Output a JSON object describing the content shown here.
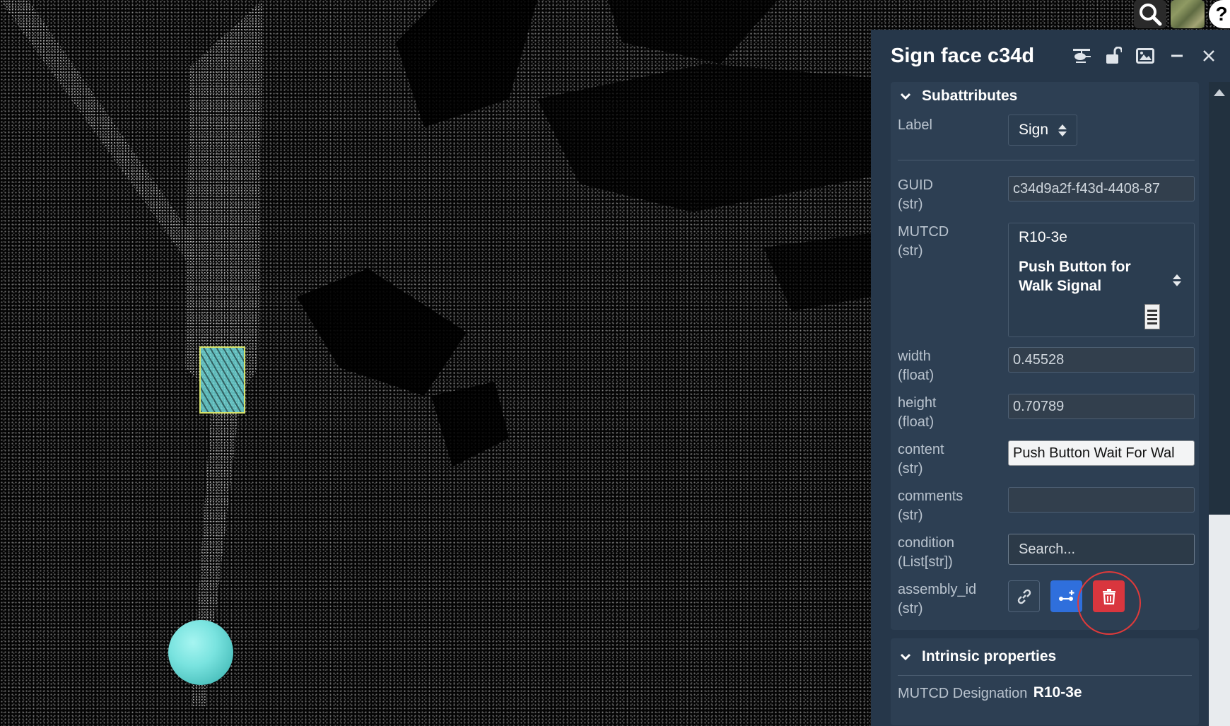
{
  "panel": {
    "title": "Sign face c34d"
  },
  "header_icons": [
    "helicopter-icon",
    "unlock-icon",
    "image-icon",
    "minimize-icon",
    "close-icon"
  ],
  "topbar": {
    "icons": [
      "search-icon",
      "map-thumbnail",
      "help-icon"
    ],
    "help_label": "?"
  },
  "subattributes": {
    "title": "Subattributes",
    "label": {
      "name": "Label",
      "value": "Sign"
    },
    "guid": {
      "name": "GUID",
      "type": "(str)",
      "value": "c34d9a2f-f43d-4408-87"
    },
    "mutcd": {
      "name": "MUTCD",
      "type": "(str)",
      "code": "R10-3e",
      "description": "Push Button for Walk Signal"
    },
    "width": {
      "name": "width",
      "type": "(float)",
      "value": "0.45528"
    },
    "height": {
      "name": "height",
      "type": "(float)",
      "value": "0.70789"
    },
    "content": {
      "name": "content",
      "type": "(str)",
      "value": "Push Button Wait For Wal"
    },
    "comments": {
      "name": "comments",
      "type": "(str)",
      "value": ""
    },
    "condition": {
      "name": "condition",
      "type": "(List[str])",
      "placeholder": "Search..."
    },
    "assembly_id": {
      "name": "assembly_id",
      "type": "(str)"
    }
  },
  "intrinsic": {
    "title": "Intrinsic properties",
    "mutcd_designation": {
      "name": "MUTCD Designation",
      "value": "R10-3e"
    }
  },
  "colors": {
    "panel_bg": "#26374a",
    "section_bg": "#2d3f53",
    "accent_blue": "#2f6fdc",
    "delete_red": "#d9363e",
    "marker_cyan": "#6ed7d7"
  }
}
